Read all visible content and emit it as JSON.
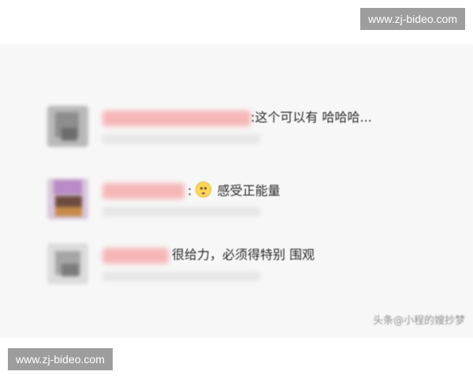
{
  "watermarks": {
    "top": "www.zj-bideo.com",
    "bottom": "www.zj-bideo.com"
  },
  "comments": [
    {
      "text": ":这个可以有 哈哈哈..."
    },
    {
      "text": ":感受正能量",
      "emoji": "smile-emoji-icon"
    },
    {
      "text": "很给力，必须得特别 围观"
    }
  ],
  "signature": "头条@小程的嫂抄梦",
  "colors": {
    "page_background": "#ffffff",
    "panel_background": "#f7f7f7",
    "name_blur": "#f6b3b3",
    "text": "#2b2b2b",
    "watermark_background": "#8c8c8c"
  }
}
